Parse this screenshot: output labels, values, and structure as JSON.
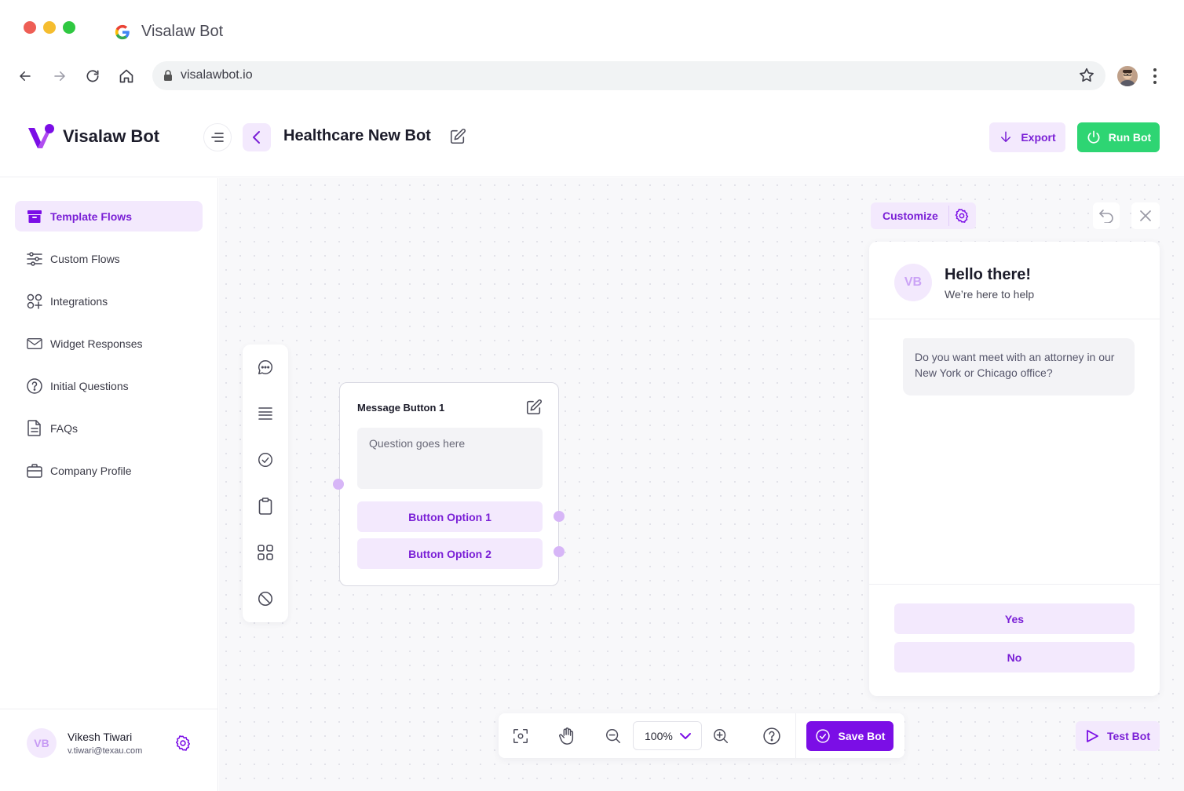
{
  "browser": {
    "tab_title": "Visalaw Bot",
    "url": "visalawbot.io"
  },
  "header": {
    "brand": "Visalaw Bot",
    "page_title": "Healthcare New Bot",
    "export_label": "Export",
    "run_label": "Run Bot"
  },
  "sidebar": {
    "items": [
      {
        "label": "Template Flows",
        "icon": "archive-icon",
        "active": true
      },
      {
        "label": "Custom Flows",
        "icon": "sliders-icon"
      },
      {
        "label": "Integrations",
        "icon": "apps-add-icon"
      },
      {
        "label": "Widget Responses",
        "icon": "mail-icon"
      },
      {
        "label": "Initial Questions",
        "icon": "help-circle-icon"
      },
      {
        "label": "FAQs",
        "icon": "document-icon"
      },
      {
        "label": "Company Profile",
        "icon": "briefcase-icon"
      }
    ],
    "user": {
      "initials": "VB",
      "name": "Vikesh Tiwari",
      "email": "v.tiwari@texau.com"
    }
  },
  "node": {
    "title": "Message Button 1",
    "question_placeholder": "Question goes here",
    "options": [
      "Button Option 1",
      "Button Option 2"
    ]
  },
  "preview": {
    "customize_label": "Customize",
    "avatar_initials": "VB",
    "greeting": "Hello there!",
    "subtitle": "We’re here to help",
    "bot_message": "Do you want meet with an attorney in our New York or Chicago office?",
    "replies": [
      "Yes",
      "No"
    ]
  },
  "toolbar": {
    "zoom": "100%",
    "save_label": "Save Bot",
    "test_label": "Test Bot"
  },
  "colors": {
    "accent": "#7b0ee6",
    "accent_light": "#f3e9fd",
    "success": "#2ed573"
  }
}
